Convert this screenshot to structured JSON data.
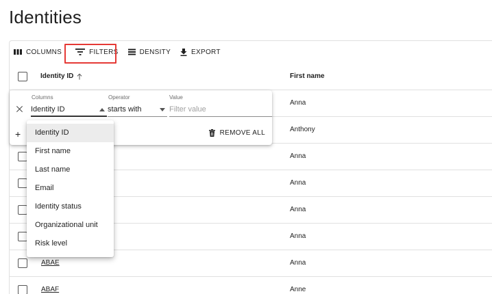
{
  "page": {
    "title": "Identities"
  },
  "toolbar": {
    "columns_label": "COLUMNS",
    "filters_label": "FILTERS",
    "density_label": "DENSITY",
    "export_label": "EXPORT"
  },
  "table": {
    "headers": {
      "identity_id": "Identity ID",
      "first_name": "First name"
    },
    "sort": "ascending",
    "rows": [
      {
        "id": "",
        "first_name": "Anna"
      },
      {
        "id": "",
        "first_name": "Anthony"
      },
      {
        "id": "",
        "first_name": "Anna"
      },
      {
        "id": "",
        "first_name": "Anna"
      },
      {
        "id": "",
        "first_name": "Anna"
      },
      {
        "id": "",
        "first_name": "Anna"
      },
      {
        "id": "ABAE",
        "first_name": "Anna"
      },
      {
        "id": "ABAF",
        "first_name": "Anne"
      }
    ]
  },
  "filter_panel": {
    "columns_label": "Columns",
    "operator_label": "Operator",
    "value_label": "Value",
    "column_value": "Identity ID",
    "operator_value": "starts with",
    "value_placeholder": "Filter value",
    "add_icon": "+",
    "remove_all_label": "REMOVE ALL"
  },
  "column_dropdown": {
    "selected": "Identity ID",
    "options": [
      "Identity ID",
      "First name",
      "Last name",
      "Email",
      "Identity status",
      "Organizational unit",
      "Risk level"
    ]
  },
  "colors": {
    "highlight": "#e53935",
    "selected_bg": "#ececec",
    "text": "#1f1f1f"
  }
}
